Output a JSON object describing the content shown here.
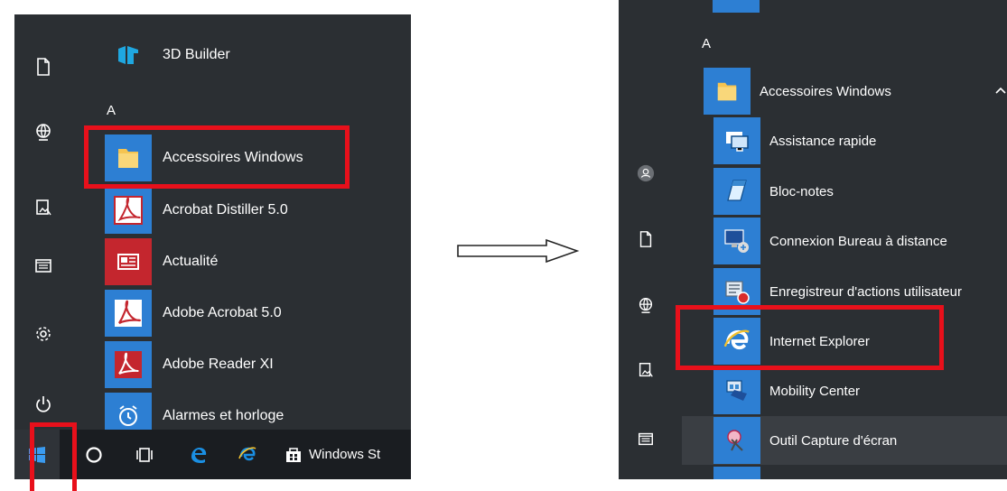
{
  "left_panel": {
    "section_letter": "A",
    "apps": [
      {
        "label": "3D Builder",
        "icon": "3d-builder-icon"
      },
      {
        "label": "Accessoires Windows",
        "icon": "folder-icon"
      },
      {
        "label": "Acrobat Distiller 5.0",
        "icon": "acrobat-distiller-icon"
      },
      {
        "label": "Actualité",
        "icon": "news-icon"
      },
      {
        "label": "Adobe Acrobat 5.0",
        "icon": "adobe-acrobat-icon"
      },
      {
        "label": "Adobe Reader XI",
        "icon": "adobe-reader-icon"
      },
      {
        "label": "Alarmes et horloge",
        "icon": "alarm-clock-icon"
      }
    ],
    "rail_icons": [
      "documents-icon",
      "network-globe-icon",
      "photos-icon",
      "file-explorer-icon",
      "settings-gear-icon",
      "power-icon"
    ],
    "taskbar": {
      "start_icon": "windows-start-icon",
      "search_icon": "cortana-circle-icon",
      "task_view_icon": "task-view-icon",
      "edge_icon": "edge-icon",
      "ie_icon": "internet-explorer-icon",
      "store_label": "Windows St",
      "store_icon": "windows-store-icon"
    }
  },
  "right_panel": {
    "section_letter": "A",
    "folder": {
      "label": "Accessoires Windows",
      "icon": "folder-icon",
      "chevron": "chevron-up-icon"
    },
    "apps": [
      {
        "label": "Assistance rapide",
        "icon": "quick-assist-icon"
      },
      {
        "label": "Bloc-notes",
        "icon": "notepad-icon"
      },
      {
        "label": "Connexion Bureau à distance",
        "icon": "remote-desktop-icon"
      },
      {
        "label": "Enregistreur d'actions utilisateur",
        "icon": "steps-recorder-icon"
      },
      {
        "label": "Internet Explorer",
        "icon": "internet-explorer-icon"
      },
      {
        "label": "Mobility Center",
        "icon": "mobility-center-icon"
      },
      {
        "label": "Outil Capture d'écran",
        "icon": "snipping-tool-icon"
      }
    ],
    "rail_icons": [
      "user-avatar-icon",
      "documents-icon",
      "network-globe-icon",
      "photos-icon",
      "file-explorer-icon"
    ]
  },
  "colors": {
    "panel_bg": "#2b2f33",
    "taskbar_bg": "#1a1d21",
    "tile_blue": "#2d7fd3",
    "tile_red": "#c4262e",
    "highlight_red": "#e8101b"
  }
}
